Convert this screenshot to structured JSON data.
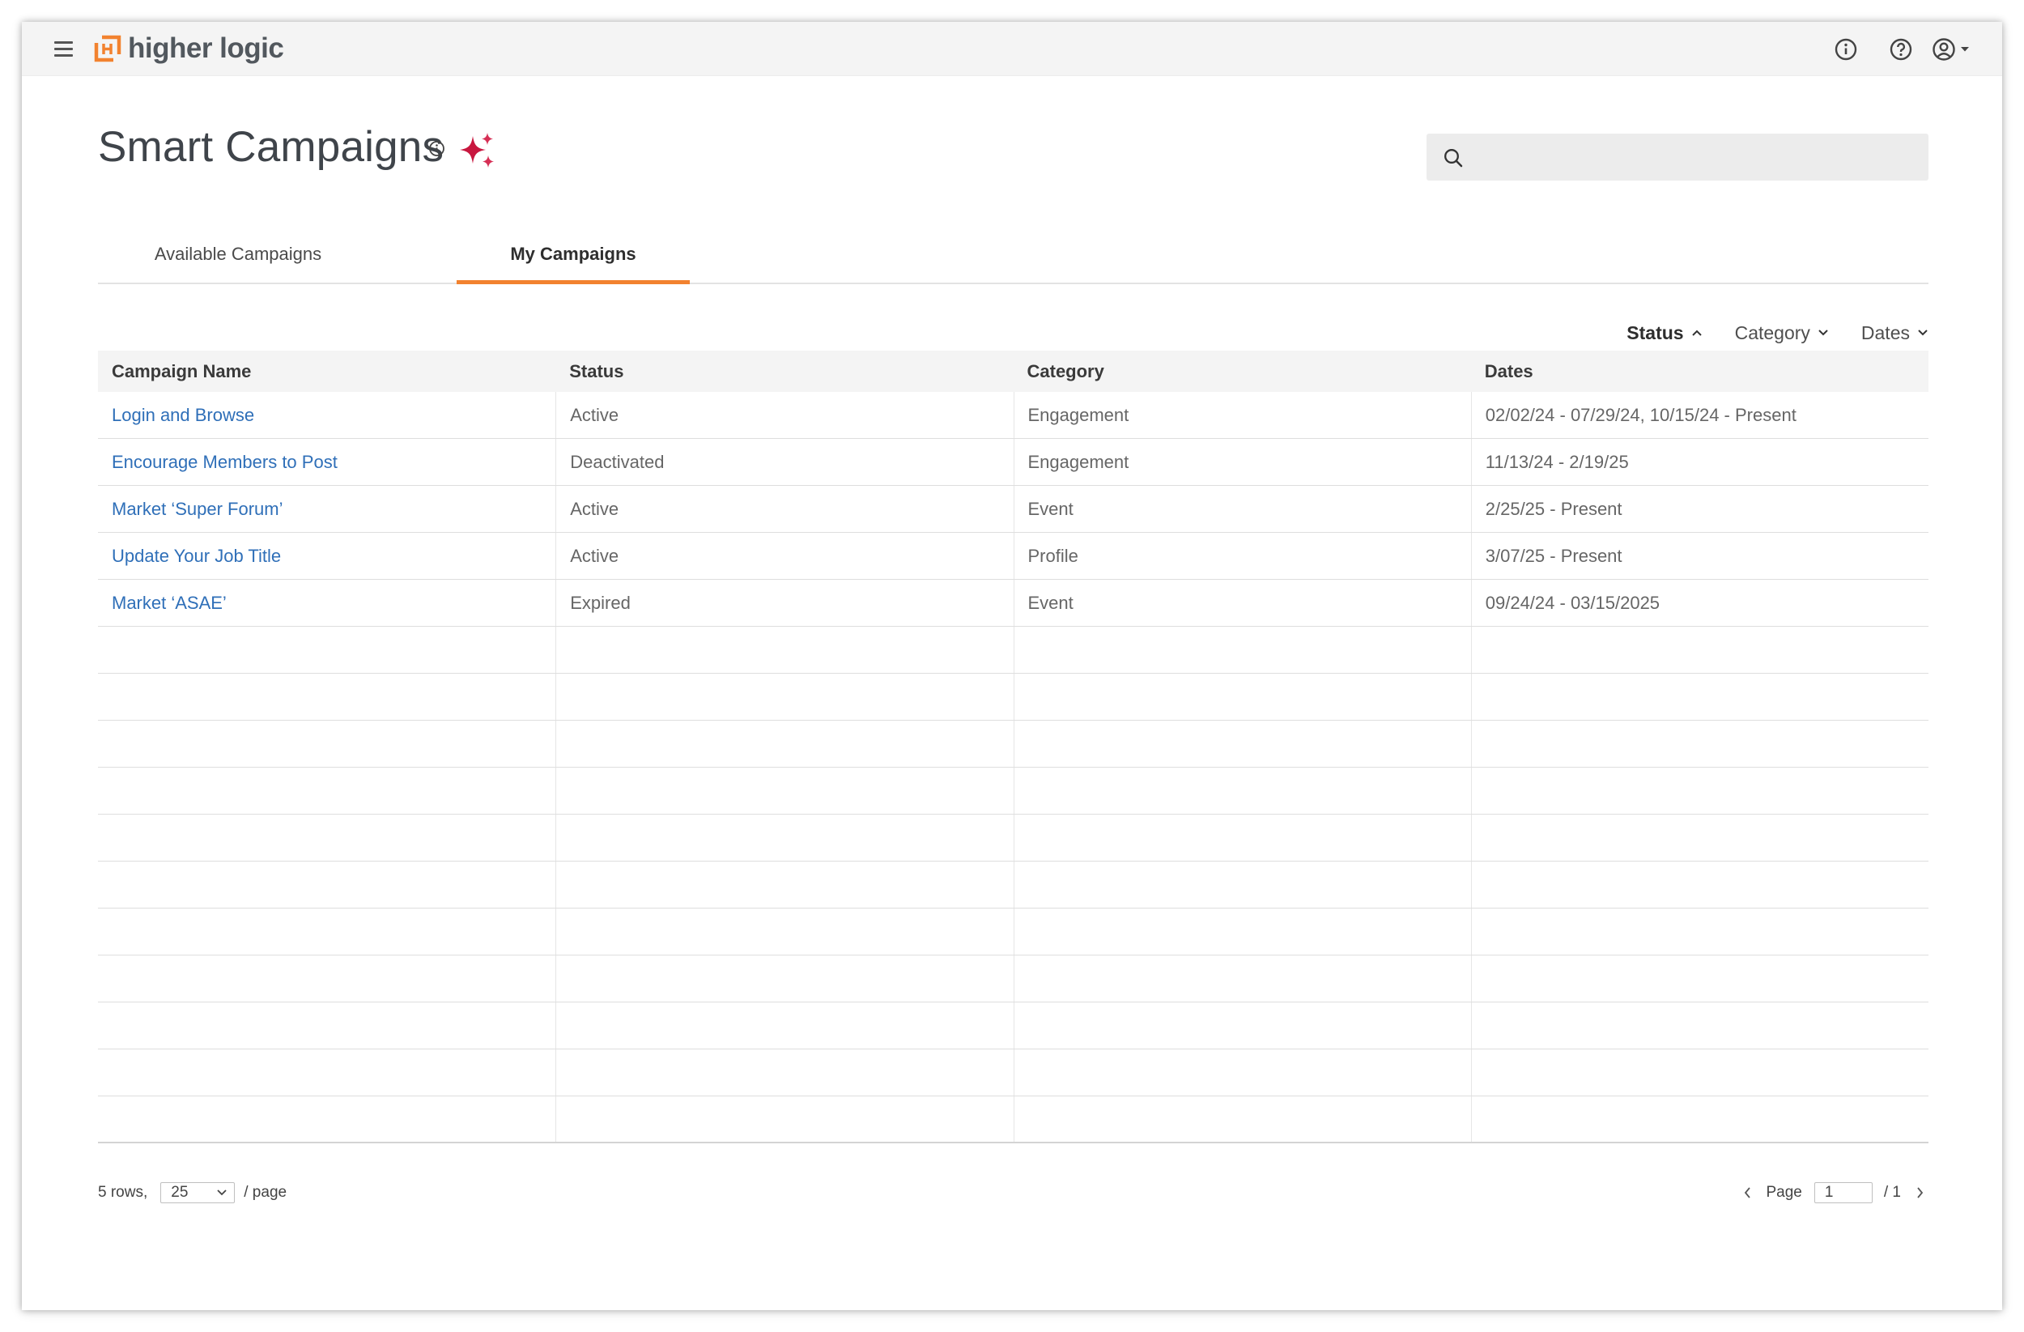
{
  "topbar": {
    "brand": "higher logic",
    "brand_color": "#f2822f",
    "icons": [
      "menu-icon",
      "info-icon",
      "help-icon",
      "user-account-icon"
    ]
  },
  "header": {
    "title": "Smart Campaigns",
    "search": {
      "placeholder": "",
      "value": ""
    }
  },
  "tabs": [
    {
      "label": "Available Campaigns",
      "active": false
    },
    {
      "label": "My Campaigns",
      "active": true
    }
  ],
  "filters": [
    {
      "label": "Status",
      "active": true,
      "icon": "chevron-up-icon"
    },
    {
      "label": "Category",
      "active": false,
      "icon": "chevron-down-icon"
    },
    {
      "label": "Dates",
      "active": false,
      "icon": "chevron-down-icon"
    }
  ],
  "table": {
    "columns": [
      "Campaign Name",
      "Status",
      "Category",
      "Dates"
    ],
    "rows": [
      [
        "Login and Browse",
        "Active",
        "Engagement",
        "02/02/24 - 07/29/24, 10/15/24 - Present"
      ],
      [
        "Encourage Members to Post",
        "Deactivated",
        "Engagement",
        "11/13/24 - 2/19/25"
      ],
      [
        "Market ‘Super Forum’",
        "Active",
        "Event",
        "2/25/25 - Present"
      ],
      [
        "Update Your Job Title",
        "Active",
        "Profile",
        "3/07/25 - Present"
      ],
      [
        "Market ‘ASAE’",
        "Expired",
        "Event",
        "09/24/24 - 03/15/2025"
      ]
    ],
    "link_color": "#2f6fb8"
  },
  "footer": {
    "rows_text": "5 rows,",
    "per_page": "25",
    "per_page_suffix": "/ page",
    "page_label": "Page",
    "page_value": "1",
    "page_total": "/ 1"
  }
}
